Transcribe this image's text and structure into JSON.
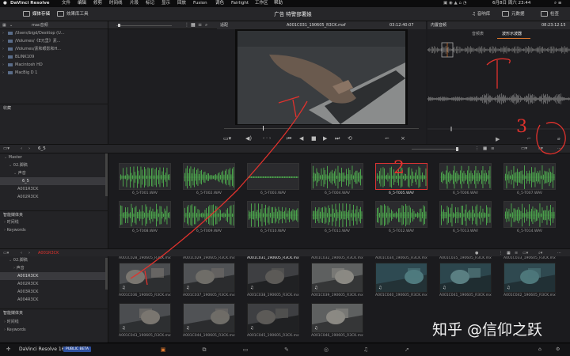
{
  "menubar": {
    "apple": "",
    "app": "DaVinci Resolve",
    "items": [
      "文件",
      "编辑",
      "修剪",
      "时间线",
      "片段",
      "标记",
      "显示",
      "回放",
      "Fusion",
      "调色",
      "Fairlight",
      "工作区",
      "帮助"
    ],
    "status": "6月8日 周六 23:44"
  },
  "toolbar": {
    "media_pool": "媒体存储",
    "effects": "效果库工具",
    "project_title": "广告 特警部署娘",
    "sound_lib": "音响库",
    "metadata": "元数据",
    "inspector": "检查"
  },
  "storage": {
    "title": "mac音频",
    "volumes": [
      "/Users/bigd/Desktop (U...",
      "/Volumes/《E元里》素...",
      "/Volumes/素和眼影和H...",
      "BLINK109",
      "Macintosh HD",
      "MacBig D 1"
    ],
    "favorites": "收藏"
  },
  "viewer": {
    "zoom": "适配",
    "clip_name": "A001C031_190605_R3CK.mxf",
    "timecode": "03:12:40:07"
  },
  "inspector": {
    "title": "内置音频",
    "timecode": "08:23:12:15",
    "tab_audio": "音频表",
    "tab_waveform": "波形示波器"
  },
  "bin1": {
    "path": "6_5",
    "tree": [
      "Master",
      "02.脚稿",
      "声音",
      "6_5",
      "A001R3CK",
      "A002R3CK"
    ],
    "smart_bins": "智能媒体夹",
    "smart_items": [
      "时间线",
      "Keywords"
    ],
    "clips": [
      "6_5-T001.WAV",
      "6_5-T002.WAV",
      "6_5-T003.WAV",
      "6_5-T004.WAV",
      "6_5-T005.WAV",
      "6_5-T006.WAV",
      "6_5-T007.WAV",
      "6_5-T008.WAV",
      "6_5-T009.WAV",
      "6_5-T010.WAV",
      "6_5-T011.WAV",
      "6_5-T012.WAV",
      "6_5-T013.WAV",
      "6_5-T014.WAV"
    ],
    "selected_index": 4
  },
  "bin2": {
    "path": "A001R3CK",
    "tree": [
      "02.脚稿",
      "声音",
      "A001R3CK",
      "A002R3CK",
      "A003R3CK",
      "A004R3CK"
    ],
    "smart_bins": "智能媒体夹",
    "smart_items": [
      "时间线",
      "Keywords"
    ],
    "top_labels": [
      "A001C028_190605_R3CK.mxf",
      "A001C029_190605_R3CK.mxf",
      "A001C031_190605_R3CK.mxf",
      "A001C032_190605_R3CK.mxf",
      "A001C034_190605_R3CK.mxf",
      "A001C035_190605_R3CK.mxf",
      "A001C033_190605_R3CK.mxf"
    ],
    "clips": [
      "A001C036_190605_R3CK.mxf",
      "A001C037_190605_R3CK.mxf",
      "A001C038_190605_R3CK.mxf",
      "A001C039_190605_R3CK.mxf",
      "A001C040_190605_R3CK.mxf",
      "A001C041_190605_R3CK.mxf",
      "A001C042_190605_R3CK.mxf",
      "A001C043_190605_R3CK.mxf",
      "A001C044_190605_R3CK.mxf",
      "A001C045_190605_R3CK.mxf",
      "A001C046_190605_R3CK.mxf"
    ]
  },
  "bottom": {
    "app": "DaVinci Resolve 16",
    "badge": "PUBLIC BETA"
  },
  "annotations": [
    "1",
    "2",
    "3"
  ],
  "watermark": "知乎 @信仰之跃",
  "colors": {
    "accent": "#e07a2f",
    "annotation": "#e0322d",
    "waveform": "#4fae4f",
    "selection": "#d33333"
  }
}
